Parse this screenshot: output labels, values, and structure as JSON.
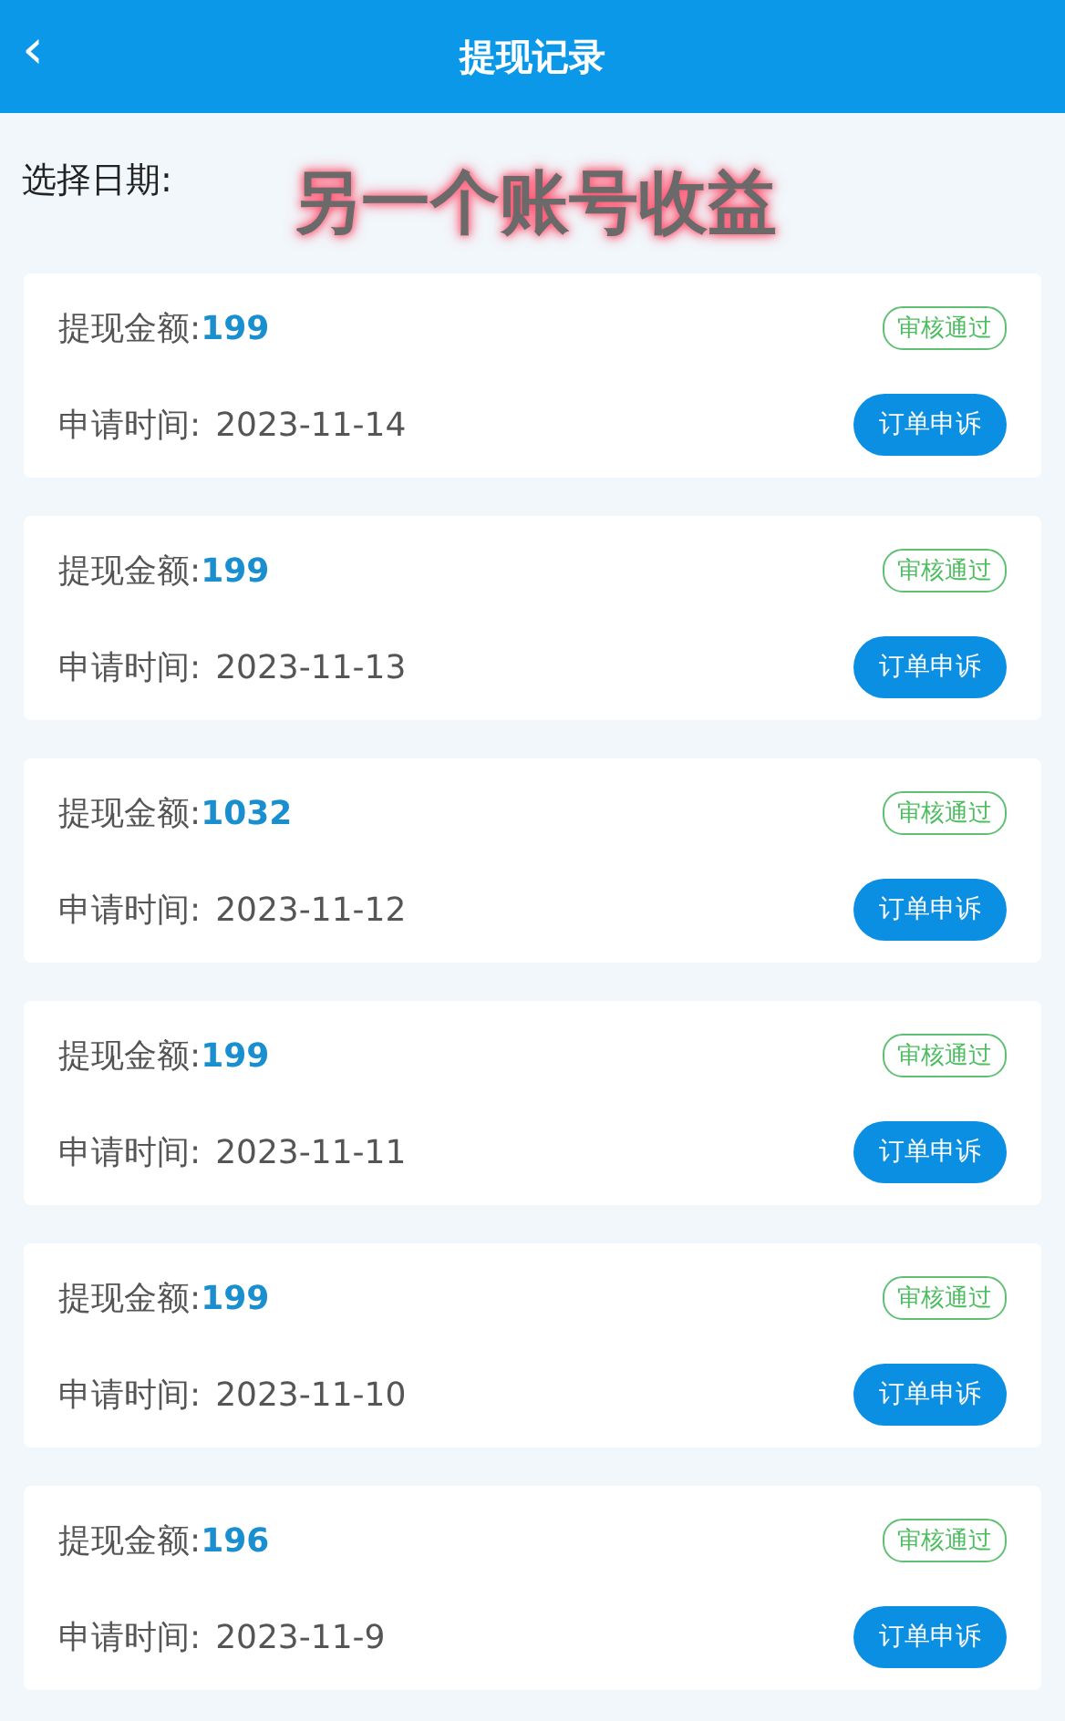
{
  "header": {
    "back": "‹",
    "title": "提现记录"
  },
  "date_filter": {
    "label": "选择日期:"
  },
  "annotation": "另一个账号收益",
  "records": [
    {
      "amount_label": "提现金额:",
      "amount": "199",
      "status": "审核通过",
      "time_label": "申请时间:",
      "time": "2023-11-14",
      "action": "订单申诉"
    },
    {
      "amount_label": "提现金额:",
      "amount": "199",
      "status": "审核通过",
      "time_label": "申请时间:",
      "time": "2023-11-13",
      "action": "订单申诉"
    },
    {
      "amount_label": "提现金额:",
      "amount": "1032",
      "status": "审核通过",
      "time_label": "申请时间:",
      "time": "2023-11-12",
      "action": "订单申诉"
    },
    {
      "amount_label": "提现金额:",
      "amount": "199",
      "status": "审核通过",
      "time_label": "申请时间:",
      "time": "2023-11-11",
      "action": "订单申诉"
    },
    {
      "amount_label": "提现金额:",
      "amount": "199",
      "status": "审核通过",
      "time_label": "申请时间:",
      "time": "2023-11-10",
      "action": "订单申诉"
    },
    {
      "amount_label": "提现金额:",
      "amount": "196",
      "status": "审核通过",
      "time_label": "申请时间:",
      "time": "2023-11-9",
      "action": "订单申诉"
    }
  ]
}
